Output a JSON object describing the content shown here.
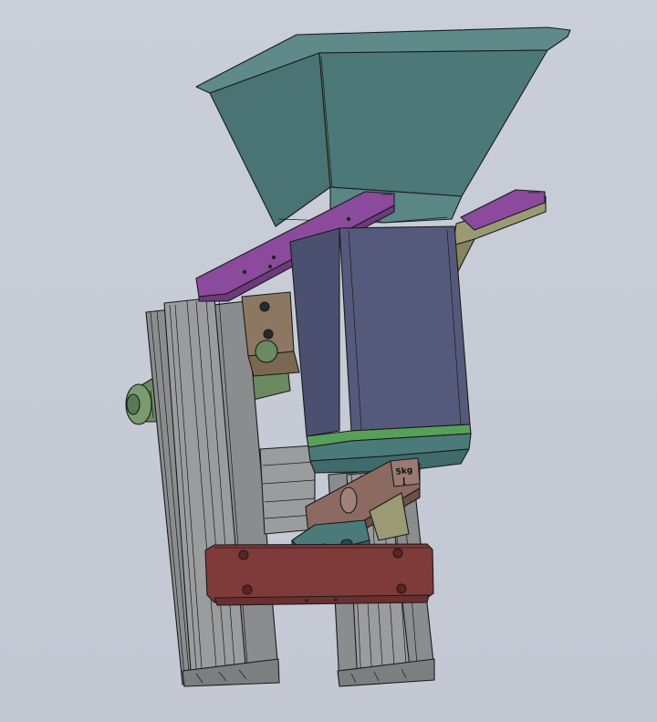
{
  "load_cell": {
    "capacity_label": "5kg"
  },
  "colors": {
    "background": "#c6cbd5",
    "hopper": "#4d7878",
    "hopper_rim": "#5e8a89",
    "bracket": "#8b4a9c",
    "chute": "#555a7c",
    "chute_band": "#58a05a",
    "support_arm": "#9a9a74",
    "extrusion": "#8a8c8e",
    "load_cell": "#8c6a62",
    "base_block": "#7f3a3a",
    "mount_block": "#8c7862",
    "motor": "#6b8a62",
    "spacer_block": "#4a7b7a"
  }
}
